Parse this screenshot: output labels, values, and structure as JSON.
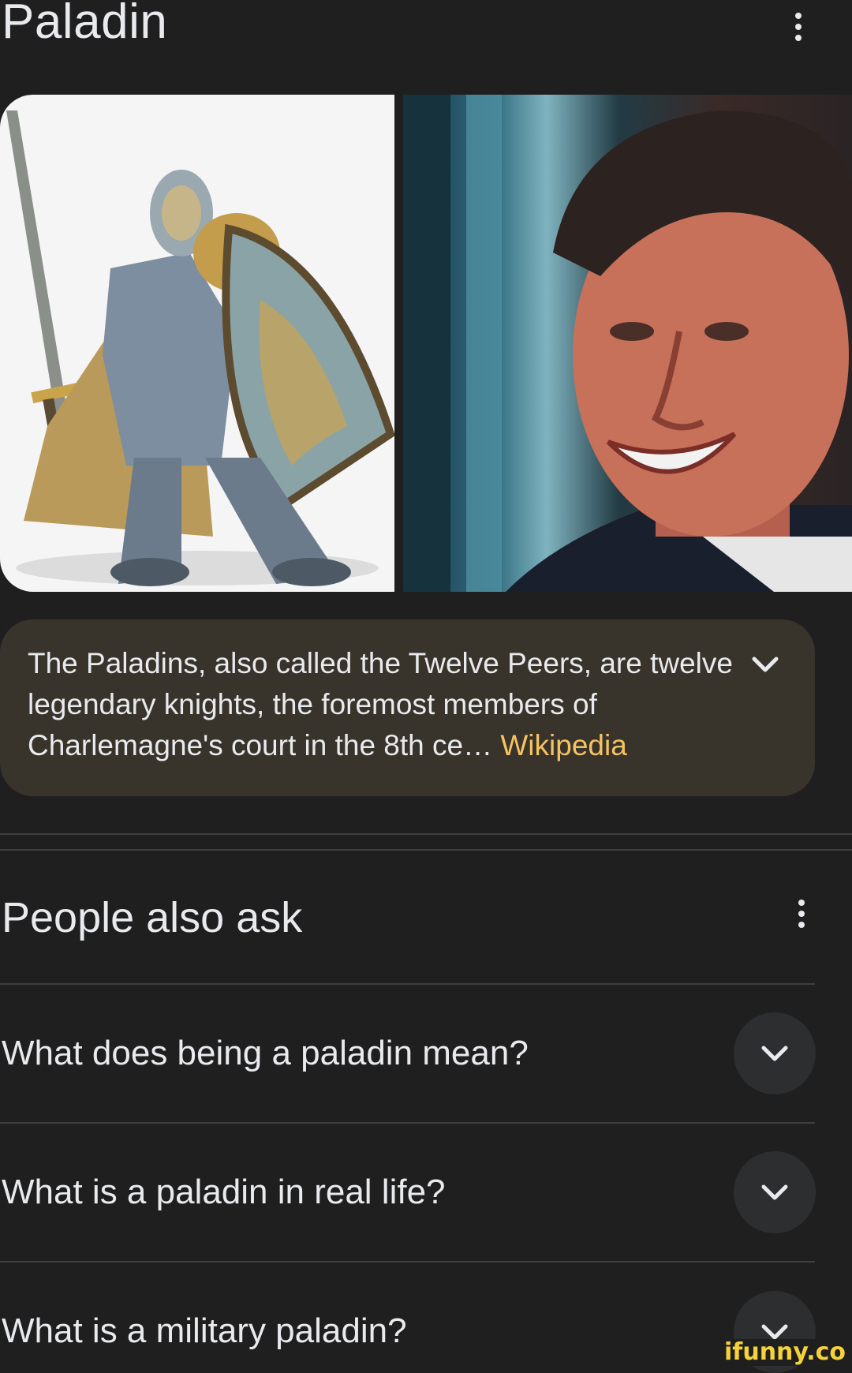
{
  "header": {
    "title": "Paladin"
  },
  "images": {
    "first": "paladin knight illustration",
    "second": "portrait photo of a smiling man"
  },
  "description": {
    "text": "The Paladins, also called the Twelve Peers, are twelve legendary knights, the foremost members of Charlemagne's court in the 8th ce… ",
    "source_link": "Wikipedia"
  },
  "people_also_ask": {
    "title": "People also ask",
    "questions": [
      "What does being a paladin mean?",
      "What is a paladin in real life?",
      "What is a military paladin?"
    ]
  },
  "watermark": "ifunny.co",
  "colors": {
    "background": "#1f1f1f",
    "card": "#38332b",
    "link": "#f5c261",
    "text": "#e8eaed"
  },
  "icons": {
    "menu": "more-vert-icon",
    "expand": "chevron-down-icon"
  }
}
